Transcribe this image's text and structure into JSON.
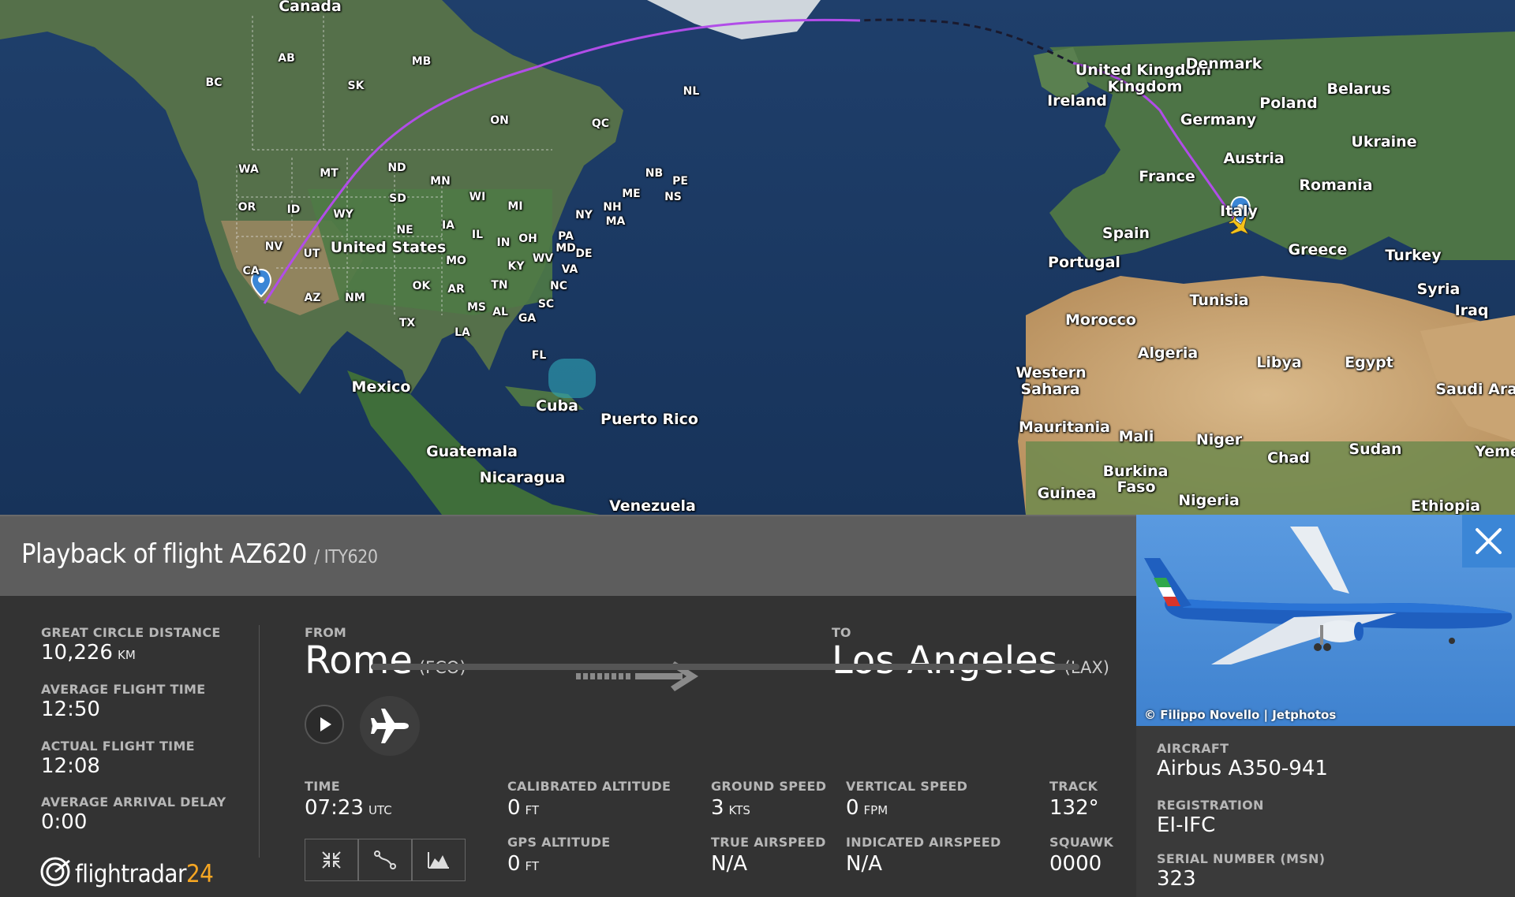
{
  "map": {
    "countries": [
      {
        "name": "Canada"
      },
      {
        "name": "United States"
      },
      {
        "name": "Mexico"
      },
      {
        "name": "Cuba"
      },
      {
        "name": "Puerto Rico"
      },
      {
        "name": "Guatemala"
      },
      {
        "name": "Nicaragua"
      },
      {
        "name": "Venezuela"
      },
      {
        "name": "United Kingdom"
      },
      {
        "name": "Ireland"
      },
      {
        "name": "Denmark"
      },
      {
        "name": "Belarus"
      },
      {
        "name": "Poland"
      },
      {
        "name": "Germany"
      },
      {
        "name": "Ukraine"
      },
      {
        "name": "Austria"
      },
      {
        "name": "France"
      },
      {
        "name": "Romania"
      },
      {
        "name": "Italy"
      },
      {
        "name": "Spain"
      },
      {
        "name": "Portugal"
      },
      {
        "name": "Greece"
      },
      {
        "name": "Turkey"
      },
      {
        "name": "Syria"
      },
      {
        "name": "Iraq"
      },
      {
        "name": "Tunisia"
      },
      {
        "name": "Morocco"
      },
      {
        "name": "Algeria"
      },
      {
        "name": "Libya"
      },
      {
        "name": "Egypt"
      },
      {
        "name": "Saudi Arab"
      },
      {
        "name": "Western"
      },
      {
        "name": "Sahara"
      },
      {
        "name": "Mauritania"
      },
      {
        "name": "Mali"
      },
      {
        "name": "Niger"
      },
      {
        "name": "Chad"
      },
      {
        "name": "Sudan"
      },
      {
        "name": "Yeme"
      },
      {
        "name": "Burkina"
      },
      {
        "name": "Faso"
      },
      {
        "name": "Guinea"
      },
      {
        "name": "Nigeria"
      },
      {
        "name": "Ethiopia"
      }
    ],
    "states": [
      "AB",
      "MB",
      "BC",
      "SK",
      "NL",
      "ON",
      "QC",
      "WA",
      "MT",
      "ND",
      "MN",
      "NB",
      "PE",
      "ME",
      "NS",
      "OR",
      "ID",
      "SD",
      "WY",
      "WI",
      "MI",
      "NY",
      "NH",
      "MA",
      "NE",
      "IA",
      "IL",
      "IN",
      "OH",
      "PA",
      "MD",
      "DE",
      "NV",
      "UT",
      "MO",
      "KY",
      "WV",
      "VA",
      "CA",
      "OK",
      "AR",
      "TN",
      "NC",
      "AZ",
      "NM",
      "TX",
      "MS",
      "AL",
      "GA",
      "SC",
      "LA",
      "FL"
    ],
    "route_color": "#b14de8",
    "route_predicted_color": "#1a1a2e"
  },
  "flight": {
    "title": "Playback of flight AZ620",
    "subtitle": "/ ITY620",
    "stats": {
      "gcd_label": "GREAT CIRCLE DISTANCE",
      "gcd_value": "10,226",
      "gcd_unit": "KM",
      "avg_time_label": "AVERAGE FLIGHT TIME",
      "avg_time_value": "12:50",
      "actual_time_label": "ACTUAL FLIGHT TIME",
      "actual_time_value": "12:08",
      "delay_label": "AVERAGE ARRIVAL DELAY",
      "delay_value": "0:00"
    },
    "from_label": "FROM",
    "from_city": "Rome",
    "from_code": "(FCO)",
    "to_label": "TO",
    "to_city": "Los Angeles",
    "to_code": "(LAX)",
    "playback_progress": 0.0,
    "telemetry": {
      "time_label": "TIME",
      "time_value": "07:23",
      "time_unit": "UTC",
      "cal_alt_label": "CALIBRATED ALTITUDE",
      "cal_alt_value": "0",
      "cal_alt_unit": "FT",
      "gps_alt_label": "GPS ALTITUDE",
      "gps_alt_value": "0",
      "gps_alt_unit": "FT",
      "ground_speed_label": "GROUND SPEED",
      "ground_speed_value": "3",
      "ground_speed_unit": "KTS",
      "tas_label": "TRUE AIRSPEED",
      "tas_value": "N/A",
      "vs_label": "VERTICAL SPEED",
      "vs_value": "0",
      "vs_unit": "FPM",
      "ias_label": "INDICATED AIRSPEED",
      "ias_value": "N/A",
      "track_label": "TRACK",
      "track_value": "132°",
      "squawk_label": "SQUAWK",
      "squawk_value": "0000"
    }
  },
  "logo": {
    "text": "flightradar",
    "number": "24"
  },
  "aircraft": {
    "photo_credit": "© Filippo Novello | Jetphotos",
    "aircraft_label": "AIRCRAFT",
    "aircraft_value": "Airbus A350-941",
    "registration_label": "REGISTRATION",
    "registration_value": "EI-IFC",
    "serial_label": "SERIAL NUMBER (MSN)",
    "serial_value": "323"
  },
  "colors": {
    "accent": "#3b86d6",
    "logo_orange": "#f5a623",
    "header_gray": "#5d5d5d"
  }
}
